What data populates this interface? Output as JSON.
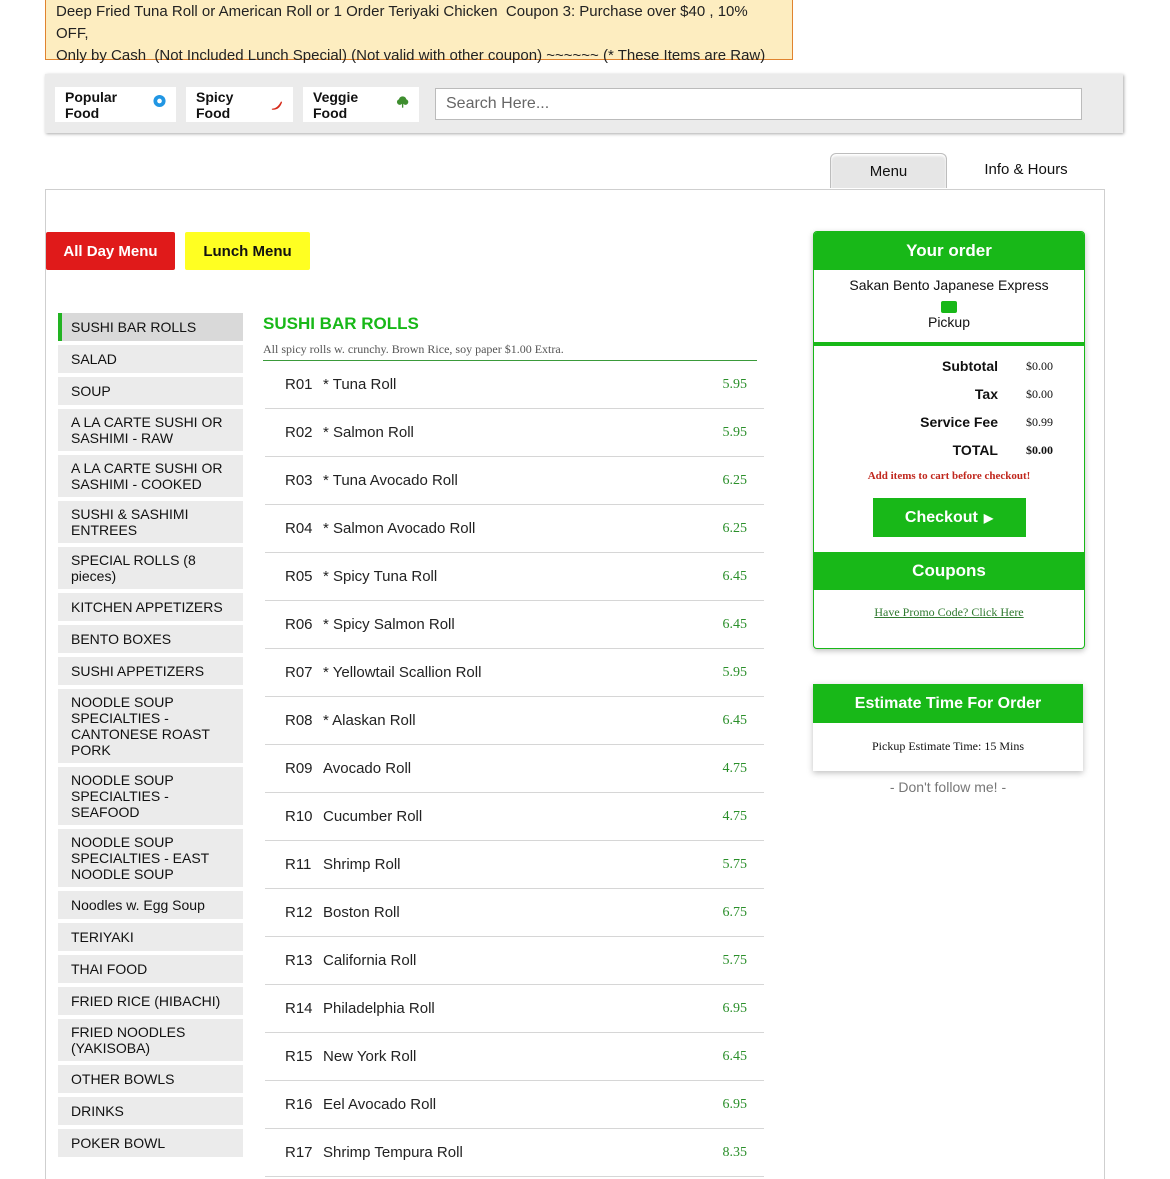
{
  "notice": {
    "line1": "Deep Fried Tuna Roll or American Roll or 1 Order Teriyaki Chicken  Coupon 3: Purchase over $40 , 10% OFF,",
    "line2": "Only by Cash  (Not Included Lunch Special) (Not valid with other coupon) ~~~~~~ (* These Items are Raw)"
  },
  "filters": [
    {
      "label": "Popular Food",
      "icon": "popular-icon"
    },
    {
      "label": "Spicy Food",
      "icon": "chili-icon"
    },
    {
      "label": "Veggie Food",
      "icon": "leaf-icon"
    }
  ],
  "search": {
    "placeholder": "Search Here..."
  },
  "tabs": {
    "menu": "Menu",
    "info": "Info & Hours"
  },
  "menu_buttons": {
    "all_day": "All Day Menu",
    "lunch": "Lunch Menu"
  },
  "colors": {
    "accent_green": "#18b818",
    "all_day_red": "#e01a1a",
    "lunch_yellow": "#ffff22"
  },
  "categories": [
    "SUSHI BAR ROLLS",
    "SALAD",
    "SOUP",
    "A LA CARTE SUSHI OR SASHIMI - RAW",
    "A LA CARTE SUSHI OR SASHIMI - COOKED",
    "SUSHI & SASHIMI ENTREES",
    "SPECIAL ROLLS (8 pieces)",
    "KITCHEN APPETIZERS",
    "BENTO BOXES",
    "SUSHI APPETIZERS",
    "NOODLE SOUP SPECIALTIES - CANTONESE ROAST PORK",
    "NOODLE SOUP SPECIALTIES - SEAFOOD",
    "NOODLE SOUP SPECIALTIES - EAST NOODLE SOUP",
    "Noodles w. Egg Soup",
    "TERIYAKI",
    "THAI FOOD",
    "FRIED RICE (HIBACHI)",
    "FRIED NOODLES (YAKISOBA)",
    "OTHER BOWLS",
    "DRINKS",
    "POKER BOWL"
  ],
  "section": {
    "title": "SUSHI BAR ROLLS",
    "subtitle": "All spicy rolls w. crunchy. Brown Rice, soy paper $1.00 Extra."
  },
  "items": [
    {
      "code": "R01",
      "name": "* Tuna Roll",
      "price": "5.95"
    },
    {
      "code": "R02",
      "name": "* Salmon Roll",
      "price": "5.95"
    },
    {
      "code": "R03",
      "name": "* Tuna Avocado Roll",
      "price": "6.25"
    },
    {
      "code": "R04",
      "name": "* Salmon Avocado Roll",
      "price": "6.25"
    },
    {
      "code": "R05",
      "name": "* Spicy Tuna Roll",
      "price": "6.45"
    },
    {
      "code": "R06",
      "name": "* Spicy Salmon Roll",
      "price": "6.45"
    },
    {
      "code": "R07",
      "name": "* Yellowtail Scallion Roll",
      "price": "5.95"
    },
    {
      "code": "R08",
      "name": "* Alaskan Roll",
      "price": "6.45"
    },
    {
      "code": "R09",
      "name": "Avocado Roll",
      "price": "4.75"
    },
    {
      "code": "R10",
      "name": "Cucumber Roll",
      "price": "4.75"
    },
    {
      "code": "R11",
      "name": "Shrimp Roll",
      "price": "5.75"
    },
    {
      "code": "R12",
      "name": "Boston Roll",
      "price": "6.75"
    },
    {
      "code": "R13",
      "name": "California Roll",
      "price": "5.75"
    },
    {
      "code": "R14",
      "name": "Philadelphia Roll",
      "price": "6.95"
    },
    {
      "code": "R15",
      "name": "New York Roll",
      "price": "6.45"
    },
    {
      "code": "R16",
      "name": "Eel Avocado Roll",
      "price": "6.95"
    },
    {
      "code": "R17",
      "name": "Shrimp Tempura Roll",
      "price": "8.35"
    }
  ],
  "order": {
    "title": "Your order",
    "restaurant": "Sakan Bento Japanese Express",
    "mode": "Pickup",
    "subtotal_label": "Subtotal",
    "subtotal": "$0.00",
    "tax_label": "Tax",
    "tax": "$0.00",
    "fee_label": "Service Fee",
    "fee": "$0.99",
    "total_label": "TOTAL",
    "total": "$0.00",
    "warning": "Add items to cart before checkout!",
    "checkout": "Checkout",
    "coupons_title": "Coupons",
    "promo": "Have Promo Code? Click Here"
  },
  "estimate": {
    "title": "Estimate Time For Order",
    "text": "Pickup Estimate Time: 15 Mins"
  },
  "footer_note": "- Don't follow me! -"
}
